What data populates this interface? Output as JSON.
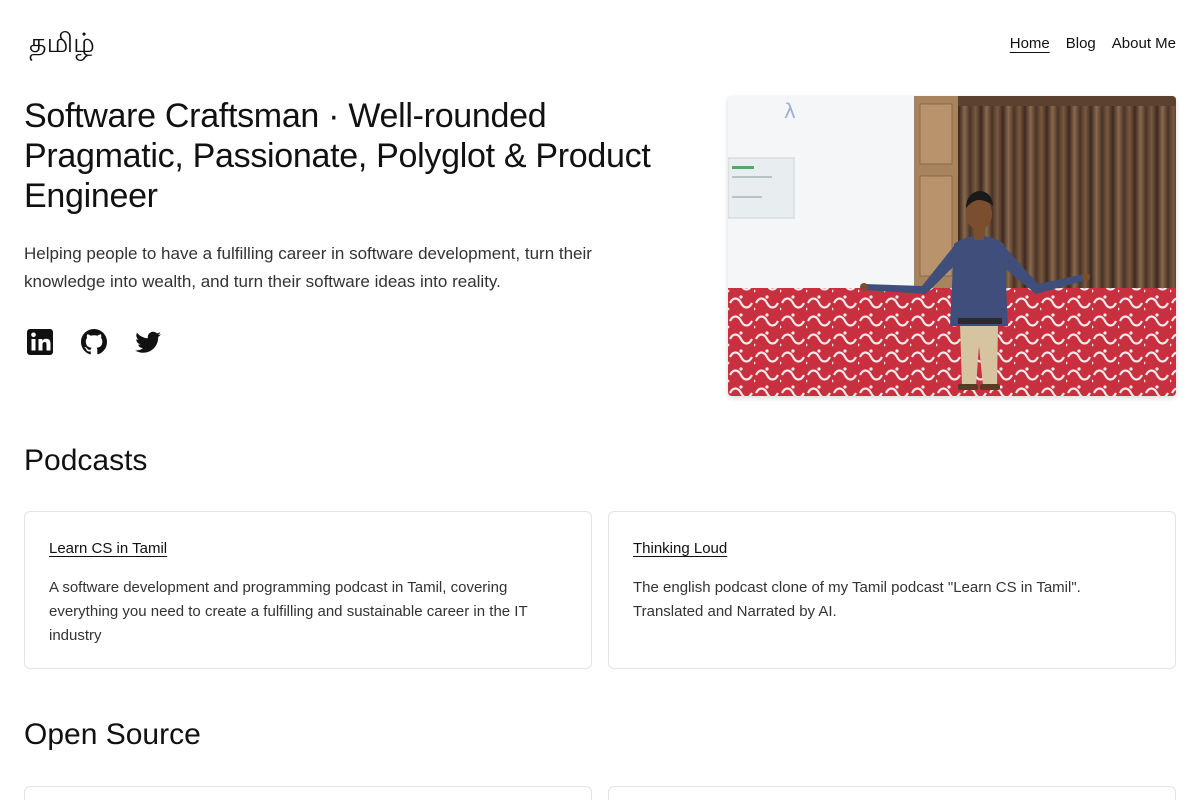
{
  "header": {
    "logo": "தமிழ்",
    "nav": [
      {
        "label": "Home",
        "active": true
      },
      {
        "label": "Blog",
        "active": false
      },
      {
        "label": "About Me",
        "active": false
      }
    ]
  },
  "hero": {
    "title": "Software Craftsman · Well-rounded Pragmatic, Passionate, Polyglot & Product Engineer",
    "subtitle": "Helping people to have a fulfilling career in software development, turn their knowledge into wealth, and turn their software ideas into reality.",
    "socials": [
      {
        "icon": "linkedin-icon"
      },
      {
        "icon": "github-icon"
      },
      {
        "icon": "twitter-icon"
      }
    ],
    "photo_screen_text": "λ"
  },
  "podcasts": {
    "title": "Podcasts",
    "items": [
      {
        "name": "Learn CS in Tamil",
        "description": "A software development and programming podcast in Tamil, covering everything you need to create a fulfilling and sustainable career in the IT industry"
      },
      {
        "name": "Thinking Loud",
        "description": "The english podcast clone of my Tamil podcast \"Learn CS in Tamil\". Translated and Narrated by AI."
      }
    ]
  },
  "open_source": {
    "title": "Open Source"
  }
}
